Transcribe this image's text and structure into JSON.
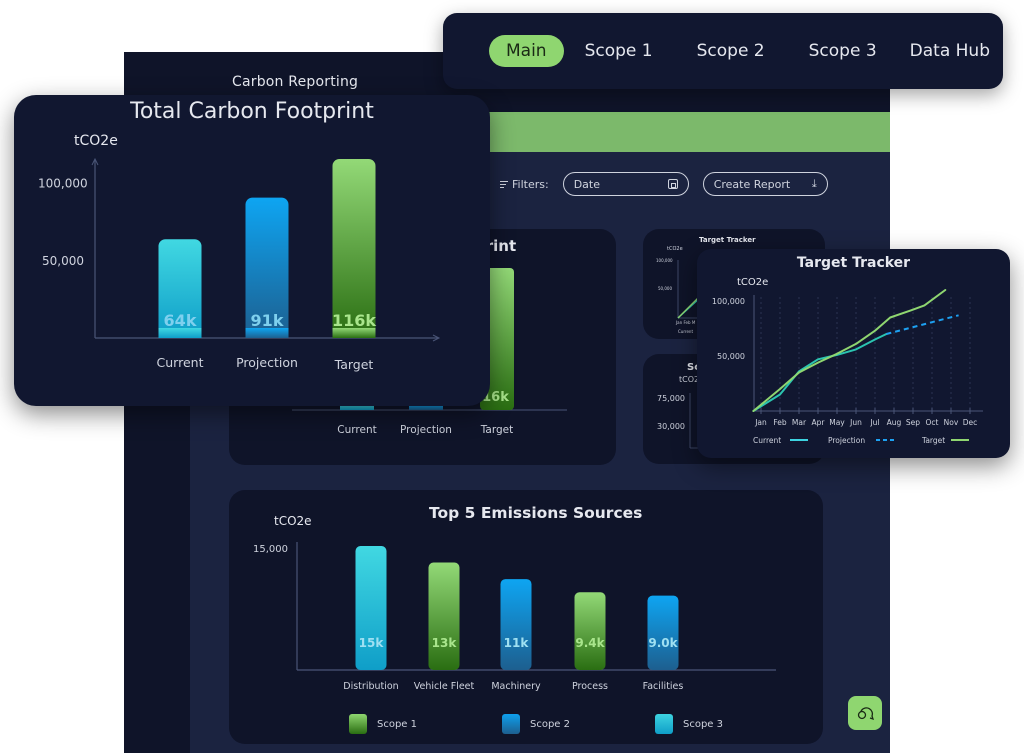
{
  "app": {
    "title": "Carbon Reporting",
    "filters_label": "Filters:",
    "date_filter": {
      "placeholder": "Date",
      "icon": "calendar-icon"
    },
    "create_report": {
      "label": "Create Report",
      "icon": "download-icon"
    },
    "help_icon": "chat-bubbles-icon",
    "colors": {
      "brand_green": "#8fd670",
      "banner_green": "#7cb96b",
      "panel": "#0f1429",
      "bg": "#1b2340"
    }
  },
  "tabs": [
    {
      "label": "Main",
      "active": true
    },
    {
      "label": "Scope 1",
      "active": false
    },
    {
      "label": "Scope 2",
      "active": false
    },
    {
      "label": "Scope 3",
      "active": false
    },
    {
      "label": "Data Hub",
      "active": false
    }
  ],
  "background_cards": {
    "footprint_title_fragment": "print",
    "target_tracker_title": "Target Tracker",
    "scope_title_fragment": "Sc",
    "scope_unit": "tCO2e",
    "scope_ticks": [
      "75,000",
      "30,000"
    ],
    "tt_mini_ticks": [
      "100,000",
      "50,000"
    ],
    "tt_mini_unit": "tCO2e",
    "tt_mini_months": [
      "Jan",
      "Feb",
      "M"
    ],
    "tt_mini_legend": "Current"
  },
  "chart_data": [
    {
      "type": "bar",
      "title": "Total Carbon Footprint",
      "ylabel": "tCO2e",
      "xlabel": "",
      "categories": [
        "Current",
        "Projection",
        "Target"
      ],
      "values": [
        64000,
        91000,
        116000
      ],
      "data_labels": [
        "64k",
        "91k",
        "116k"
      ],
      "colors": [
        "#3dd3e0",
        "#0ea0ee",
        "#8fd670"
      ],
      "yticks": [
        50000,
        100000
      ],
      "ytick_labels": [
        "50,000",
        "100,000"
      ],
      "ylim": [
        0,
        116000
      ]
    },
    {
      "type": "line",
      "title": "Target Tracker",
      "ylabel": "tCO2e",
      "x": [
        "Jan",
        "Feb",
        "Mar",
        "Apr",
        "May",
        "Jun",
        "Jul",
        "Aug",
        "Sep",
        "Oct",
        "Nov",
        "Dec"
      ],
      "yticks": [
        50000,
        100000
      ],
      "ytick_labels": [
        "50,000",
        "100,000"
      ],
      "ylim": [
        0,
        115000
      ],
      "grid": "vertical-dashed",
      "legend": "bottom",
      "series": [
        {
          "name": "Current",
          "style": "solid",
          "color": "#2bc4b0",
          "points": [
            [
              -0.4,
              0
            ],
            [
              1,
              15000
            ],
            [
              2,
              36000
            ],
            [
              3,
              47000
            ],
            [
              4,
              51000
            ],
            [
              5,
              56000
            ],
            [
              6,
              65000
            ],
            [
              6.6,
              70000
            ]
          ]
        },
        {
          "name": "Projection",
          "style": "dashed",
          "color": "#1da1f2",
          "points": [
            [
              6.6,
              70000
            ],
            [
              10.4,
              87000
            ]
          ]
        },
        {
          "name": "Target",
          "style": "solid",
          "color": "#8fd670",
          "points": [
            [
              -0.4,
              0
            ],
            [
              1,
              20000
            ],
            [
              2,
              35000
            ],
            [
              3,
              44000
            ],
            [
              4,
              52000
            ],
            [
              5,
              61000
            ],
            [
              6,
              73000
            ],
            [
              6.8,
              85000
            ],
            [
              7.9,
              91500
            ],
            [
              8.6,
              96000
            ],
            [
              9.7,
              110000
            ]
          ]
        }
      ]
    },
    {
      "type": "bar",
      "title": "Top 5 Emissions Sources",
      "ylabel": "tCO2e",
      "categories": [
        "Distribution",
        "Vehicle Fleet",
        "Machinery",
        "Process",
        "Facilities"
      ],
      "values": [
        15000,
        13000,
        11000,
        9400,
        9000
      ],
      "data_labels": [
        "15k",
        "13k",
        "11k",
        "9.4k",
        "9.0k"
      ],
      "scopes": [
        "Scope 3",
        "Scope 1",
        "Scope 2",
        "Scope 1",
        "Scope 2"
      ],
      "yticks": [
        15000
      ],
      "ytick_labels": [
        "15,000"
      ],
      "ylim": [
        0,
        15000
      ],
      "legend": [
        {
          "name": "Scope 1",
          "color": "#8fd670"
        },
        {
          "name": "Scope 2",
          "color": "#0ea0ee"
        },
        {
          "name": "Scope 3",
          "color": "#3dd3e0"
        }
      ]
    }
  ]
}
